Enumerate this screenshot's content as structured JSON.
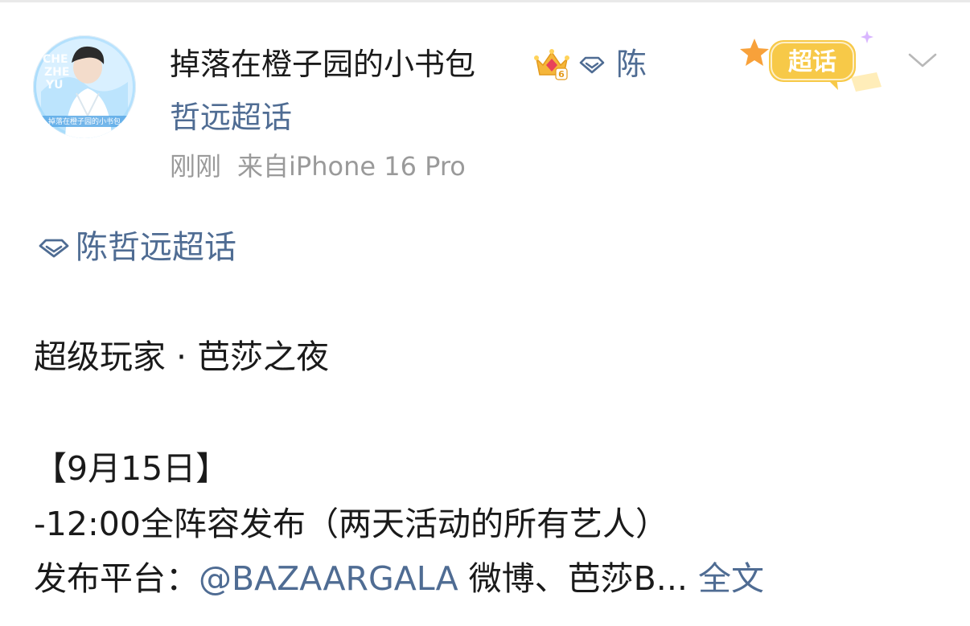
{
  "post": {
    "username": "掉落在橙子园的小书包",
    "topic_name_part1": "陈",
    "topic_name_part2": "哲远超话",
    "timestamp": "刚刚",
    "source": "来自iPhone 16 Pro",
    "badge_label": "超话",
    "crown_level": "6",
    "avatar_text_top": "CHE ZHE YU",
    "avatar_text_banner": "掉落在橙子园的小书包"
  },
  "content": {
    "topic_tag": "陈哲远超话",
    "title_line": "超级玩家 · 芭莎之夜",
    "date_line": "【9月15日】",
    "schedule_line": "-12:00全阵容发布（两天活动的所有艺人）",
    "platform_label": "发布平台：",
    "platform_mention": "@BAZAARGALA",
    "platform_rest": " 微博、芭莎B...",
    "more_label": " 全文"
  },
  "icons": {
    "crown": "crown-level-icon",
    "topic": "super-topic-diamond-icon",
    "badge": "chaohua-badge-icon",
    "menu": "chevron-down-icon"
  },
  "colors": {
    "link": "#4f6c93",
    "meta": "#9a9a9a",
    "text": "#1a1a1a",
    "badge": "#f7c948"
  }
}
